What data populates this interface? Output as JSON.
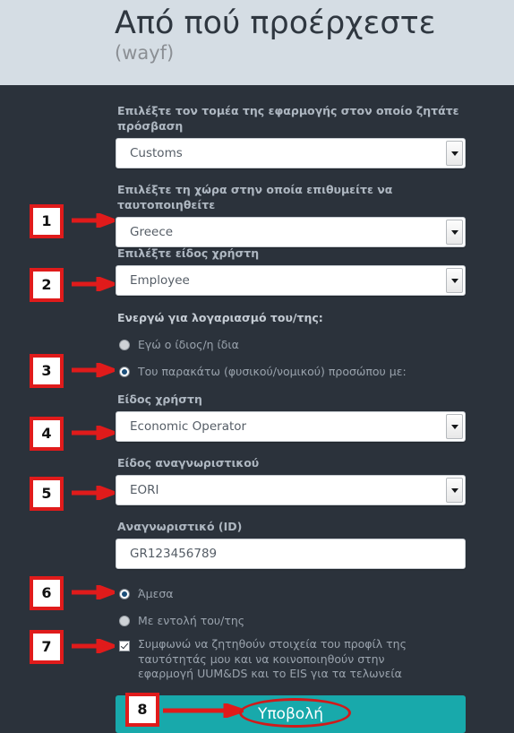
{
  "header": {
    "title": "Από πού προέρχεστε",
    "subtitle": "(wayf)"
  },
  "colors": {
    "header_bg": "#d5dde4",
    "page_bg": "#2b323b",
    "label": "#aeb7c1",
    "submit_bg": "#18a9ab",
    "annotation_red": "#e01b1b",
    "radio_selected_dot": "#1b4f7a"
  },
  "form": {
    "domain_field": {
      "label": "Επιλέξτε τον τομέα της εφαρμογής στον οποίο ζητάτε πρόσβαση",
      "value": "Customs",
      "icon": "chevron-down-icon"
    },
    "country_field": {
      "label": "Επιλέξτε τη χώρα στην οποία επιθυμείτε να ταυτοποιηθείτε",
      "value": "Greece",
      "icon": "chevron-down-icon"
    },
    "user_type_field": {
      "label": "Επιλέξτε είδος χρήστη",
      "value": "Employee",
      "icon": "chevron-down-icon"
    },
    "acting_group": {
      "label": "Ενεργώ για λογαριασμό του/της:",
      "options": [
        {
          "label": "Εγώ ο ίδιος/η ίδια",
          "selected": false
        },
        {
          "label": "Του παρακάτω (φυσικού/νομικού) προσώπου με:",
          "selected": true
        }
      ]
    },
    "person_type_field": {
      "label": "Είδος χρήστη",
      "value": "Economic Operator",
      "icon": "chevron-down-icon"
    },
    "id_type_field": {
      "label": "Είδος αναγνωριστικού",
      "value": "EORI",
      "icon": "chevron-down-icon"
    },
    "id_field": {
      "label": "Αναγνωριστικό (ID)",
      "value": "GR123456789",
      "placeholder": "Αναγνωριστικό (ID)"
    },
    "mandate_group": {
      "options": [
        {
          "label": "Άμεσα",
          "selected": true
        },
        {
          "label": "Με εντολή του/της",
          "selected": false
        }
      ]
    },
    "consent": {
      "checked": true,
      "label": "Συμφωνώ να ζητηθούν στοιχεία του προφίλ της ταυτότητάς μου και να κοινοποιηθούν στην εφαρμογή UUM&DS και το EIS για τα τελωνεία"
    },
    "submit": {
      "label": "Υποβολή"
    }
  },
  "annotations": {
    "steps": [
      {
        "number": "1"
      },
      {
        "number": "2"
      },
      {
        "number": "3"
      },
      {
        "number": "4"
      },
      {
        "number": "5"
      },
      {
        "number": "6"
      },
      {
        "number": "7"
      },
      {
        "number": "8"
      }
    ]
  }
}
